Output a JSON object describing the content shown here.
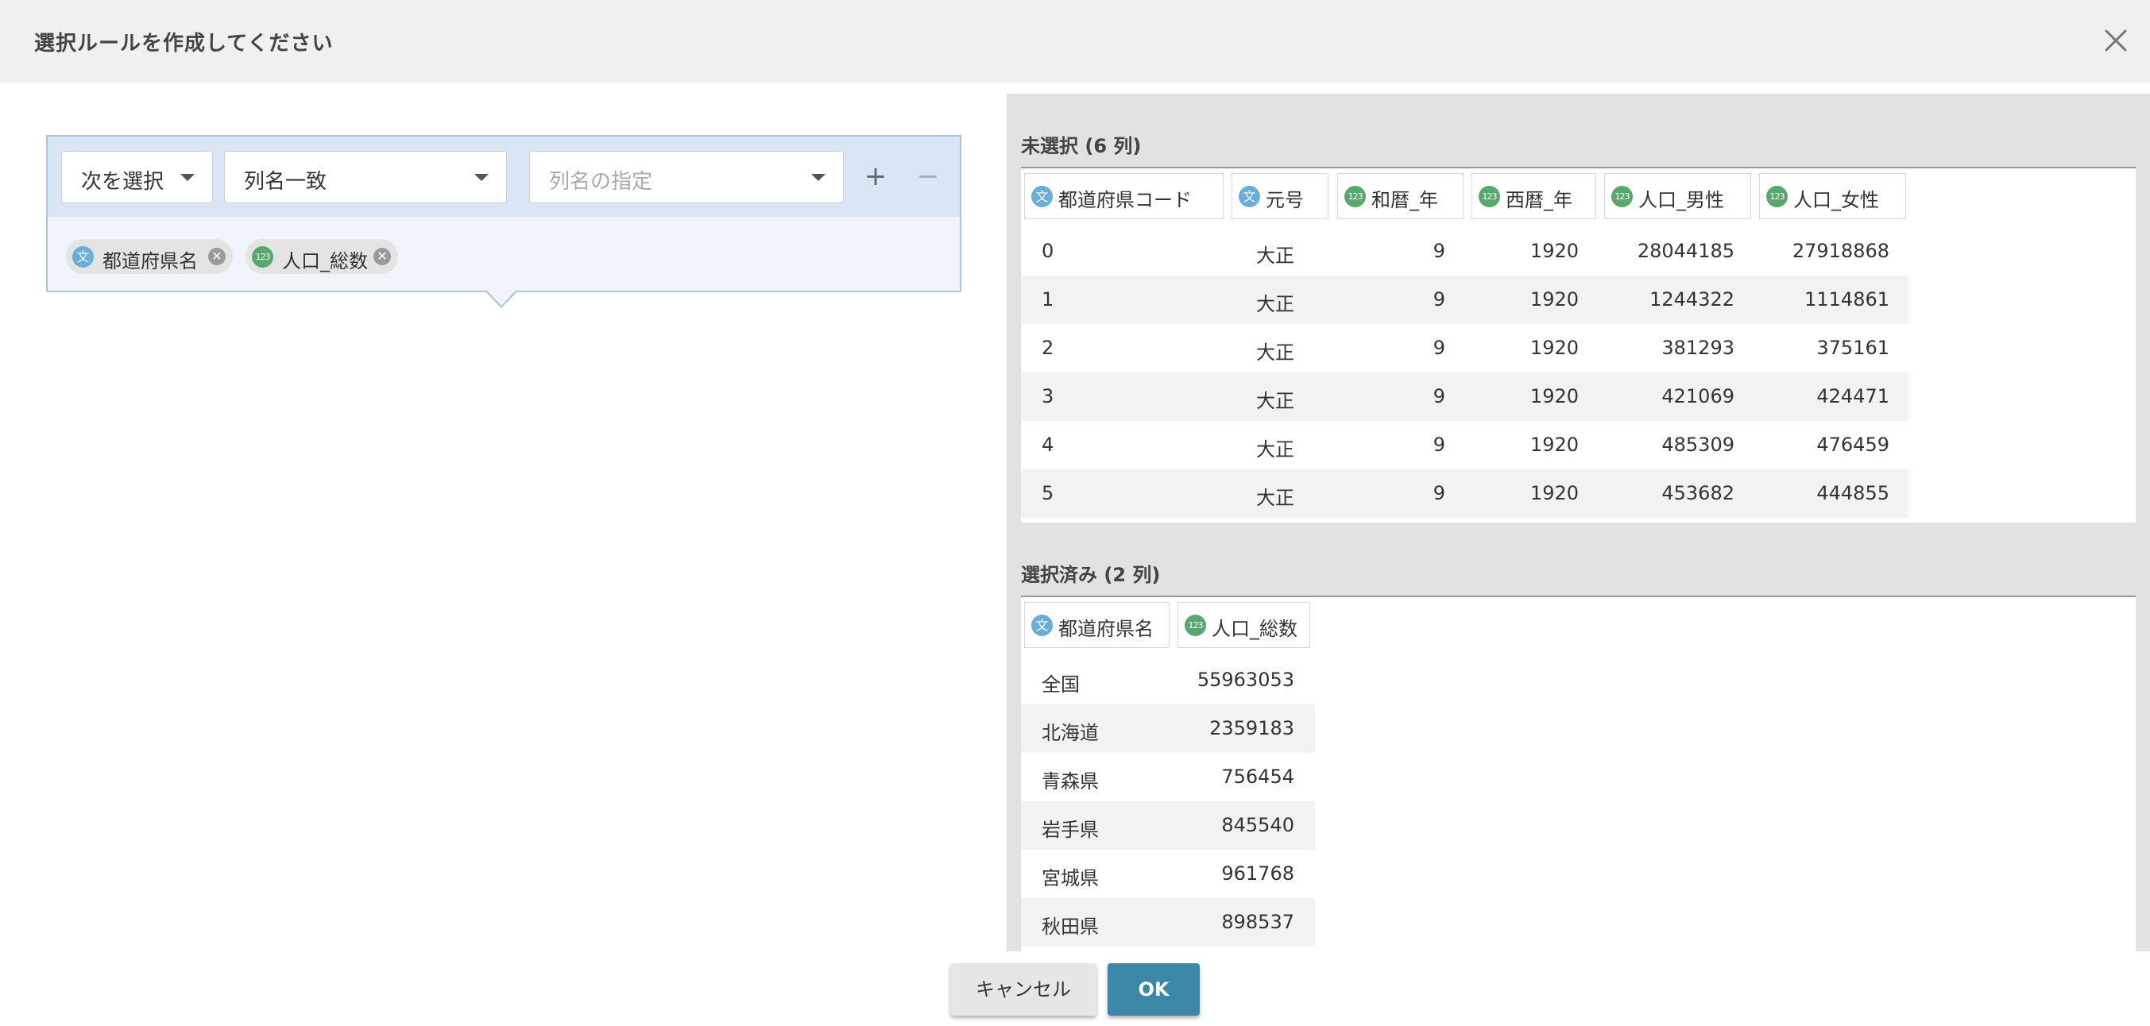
{
  "dialog": {
    "title": "選択ルールを作成してください",
    "close_icon": "close-icon"
  },
  "rule": {
    "mode_select": "次を選択",
    "match_select": "列名一致",
    "column_placeholder": "列名の指定",
    "add_label": "+",
    "remove_label": "−",
    "chips": [
      {
        "type": "string",
        "icon_text": "文",
        "label": "都道府県名"
      },
      {
        "type": "number",
        "icon_text": "123",
        "label": "人口_総数"
      }
    ]
  },
  "unselected": {
    "title": "未選択 (6 列)",
    "columns": [
      {
        "type": "string",
        "icon_text": "文",
        "label": "都道府県コード"
      },
      {
        "type": "string",
        "icon_text": "文",
        "label": "元号"
      },
      {
        "type": "number",
        "icon_text": "123",
        "label": "和暦_年"
      },
      {
        "type": "number",
        "icon_text": "123",
        "label": "西暦_年"
      },
      {
        "type": "number",
        "icon_text": "123",
        "label": "人口_男性"
      },
      {
        "type": "number",
        "icon_text": "123",
        "label": "人口_女性"
      }
    ],
    "rows": [
      [
        "0",
        "大正",
        "9",
        "1920",
        "28044185",
        "27918868"
      ],
      [
        "1",
        "大正",
        "9",
        "1920",
        "1244322",
        "1114861"
      ],
      [
        "2",
        "大正",
        "9",
        "1920",
        "381293",
        "375161"
      ],
      [
        "3",
        "大正",
        "9",
        "1920",
        "421069",
        "424471"
      ],
      [
        "4",
        "大正",
        "9",
        "1920",
        "485309",
        "476459"
      ],
      [
        "5",
        "大正",
        "9",
        "1920",
        "453682",
        "444855"
      ]
    ]
  },
  "selected": {
    "title": "選択済み (2 列)",
    "columns": [
      {
        "type": "string",
        "icon_text": "文",
        "label": "都道府県名"
      },
      {
        "type": "number",
        "icon_text": "123",
        "label": "人口_総数"
      }
    ],
    "rows": [
      [
        "全国",
        "55963053"
      ],
      [
        "北海道",
        "2359183"
      ],
      [
        "青森県",
        "756454"
      ],
      [
        "岩手県",
        "845540"
      ],
      [
        "宮城県",
        "961768"
      ],
      [
        "秋田県",
        "898537"
      ]
    ]
  },
  "footer": {
    "cancel_label": "キャンセル",
    "ok_label": "OK"
  },
  "colors": {
    "accent": "#3a87a8",
    "string_icon": "#6aaed8",
    "number_icon": "#58a86e",
    "rule_border": "#a8c6e2"
  }
}
